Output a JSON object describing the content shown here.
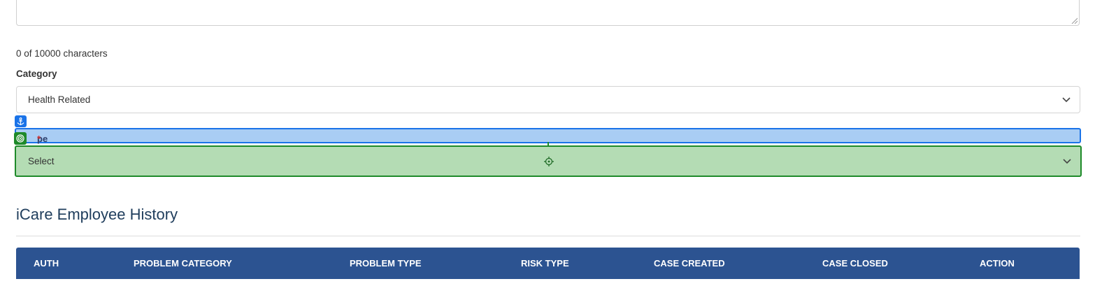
{
  "description": {
    "char_count": "0 of 10000 characters"
  },
  "category": {
    "label": "Category",
    "value": "Health Related"
  },
  "type": {
    "label_visible": "pe",
    "required_mark": "*",
    "value": "Select"
  },
  "history": {
    "title": "iCare Employee History",
    "columns": [
      "AUTH",
      "PROBLEM CATEGORY",
      "PROBLEM TYPE",
      "RISK TYPE",
      "CASE CREATED",
      "CASE CLOSED",
      "ACTION"
    ]
  },
  "colors": {
    "header_bg": "#2c5391",
    "title_color": "#1f3d5c",
    "anchor_highlight": "#1a73e8",
    "target_highlight": "#1e8a2a"
  },
  "icons": {
    "anchor": "anchor-icon",
    "target": "target-icon",
    "crosshair": "crosshair-icon",
    "chevron": "chevron-down-icon"
  }
}
